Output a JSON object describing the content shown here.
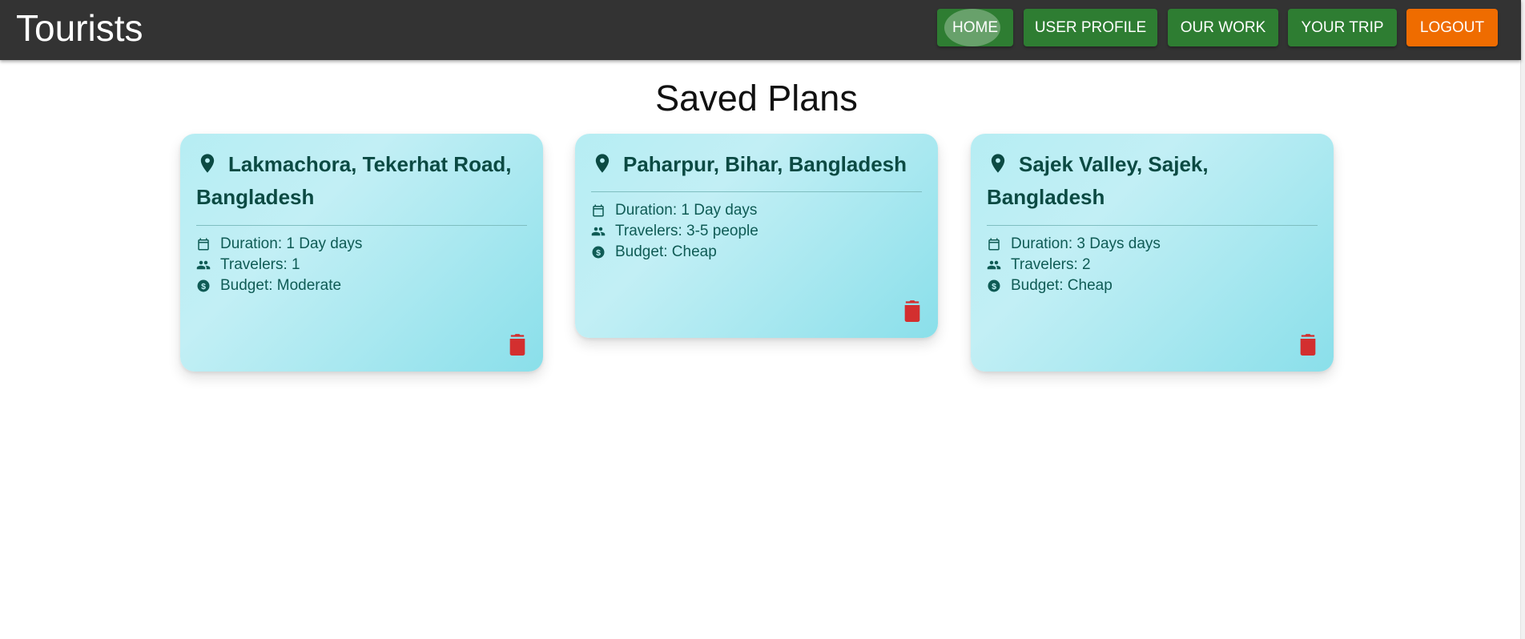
{
  "app": {
    "title": "Tourists"
  },
  "nav": {
    "home": "HOME",
    "user_profile": "USER PROFILE",
    "our_work": "OUR WORK",
    "your_trip": "YOUR TRIP",
    "logout": "LOGOUT"
  },
  "page": {
    "heading": "Saved Plans"
  },
  "colors": {
    "appbar": "#333333",
    "nav_green": "#2e7d32",
    "nav_orange": "#ef6c00",
    "card_text": "#0b4a43",
    "delete_red": "#d32f2f"
  },
  "plans": [
    {
      "location_line1": "Lakmachora, Tekerhat Road,",
      "location_line2": "Bangladesh",
      "duration": "Duration: 1 Day days",
      "travelers": "Travelers: 1",
      "budget": "Budget: Moderate"
    },
    {
      "location_line1": "Paharpur, Bihar, Bangladesh",
      "location_line2": "",
      "duration": "Duration: 1 Day days",
      "travelers": "Travelers: 3-5 people",
      "budget": "Budget: Cheap"
    },
    {
      "location_line1": "Sajek Valley, Sajek,",
      "location_line2": "Bangladesh",
      "duration": "Duration: 3 Days days",
      "travelers": "Travelers: 2",
      "budget": "Budget: Cheap"
    }
  ],
  "icons": {
    "location": "location-pin-icon",
    "duration": "calendar-icon",
    "travelers": "people-icon",
    "budget": "dollar-circle-icon",
    "delete": "trash-icon"
  }
}
